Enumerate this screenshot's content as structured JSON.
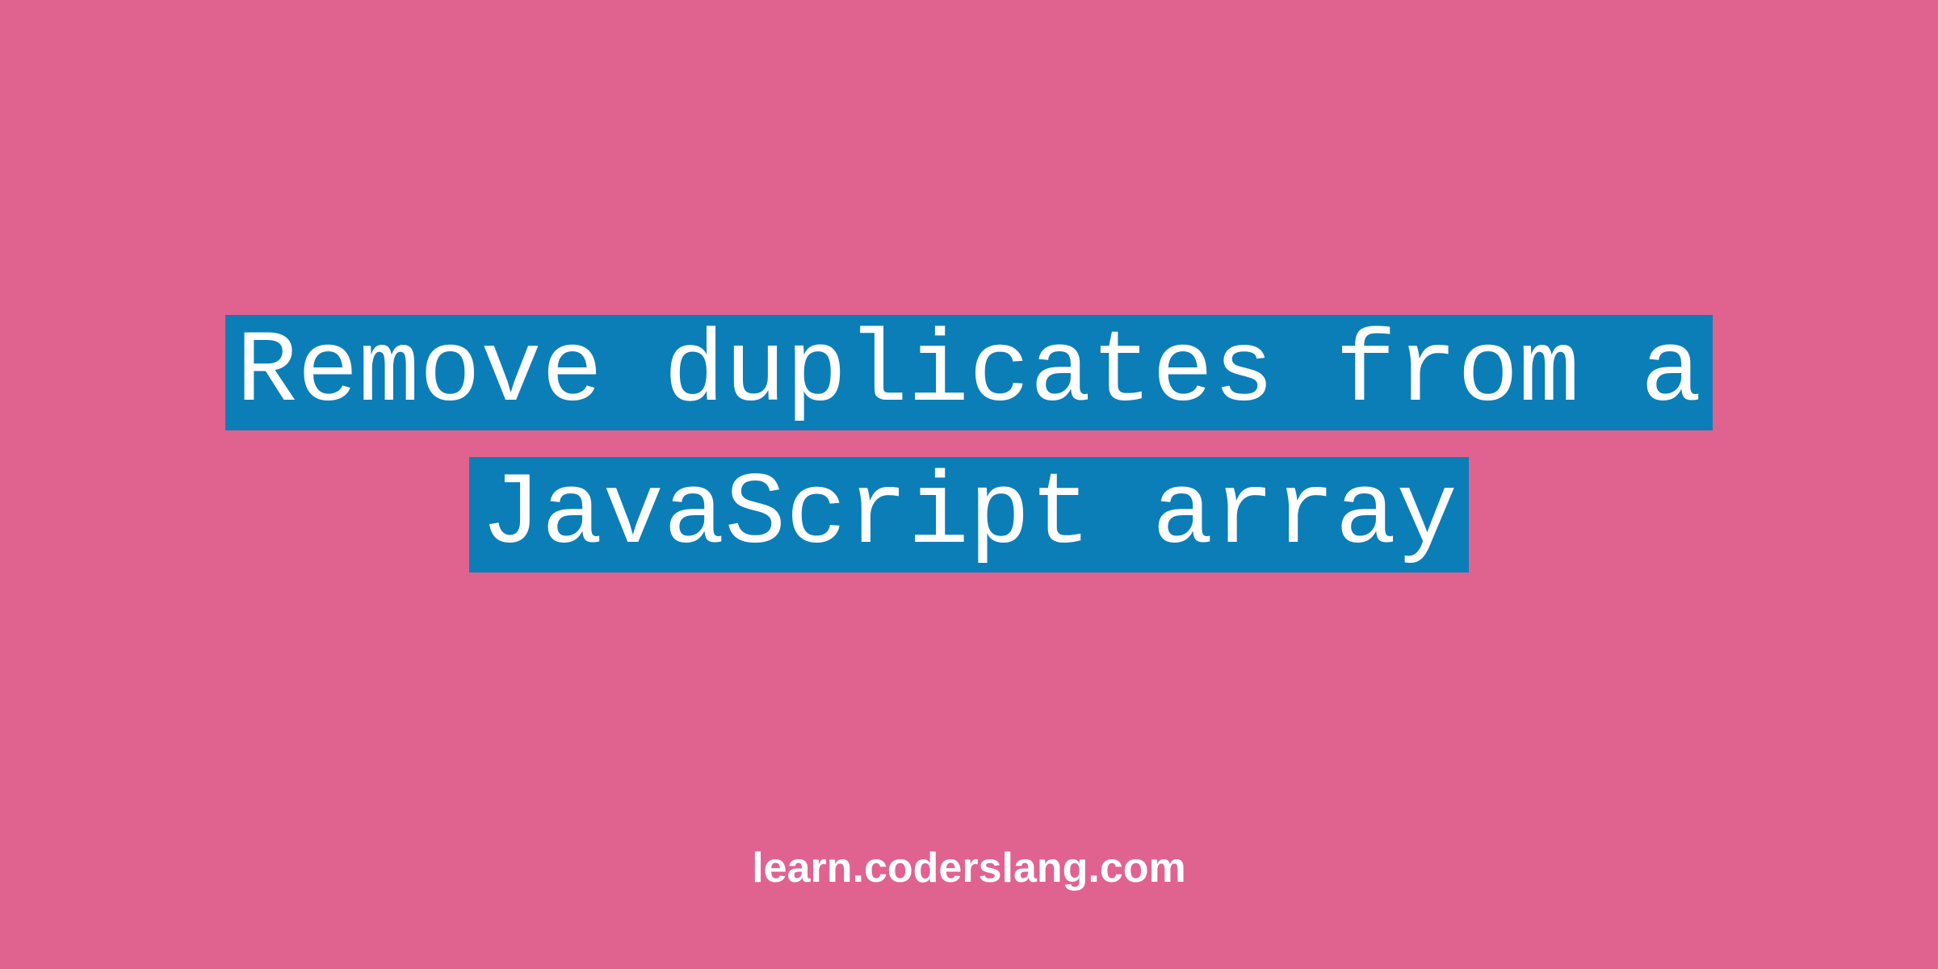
{
  "main": {
    "title": "Remove duplicates from a JavaScript array"
  },
  "footer": {
    "url": "learn.coderslang.com"
  },
  "colors": {
    "background": "#e0628f",
    "highlight": "#0b7eb7",
    "text": "#ffffff"
  }
}
